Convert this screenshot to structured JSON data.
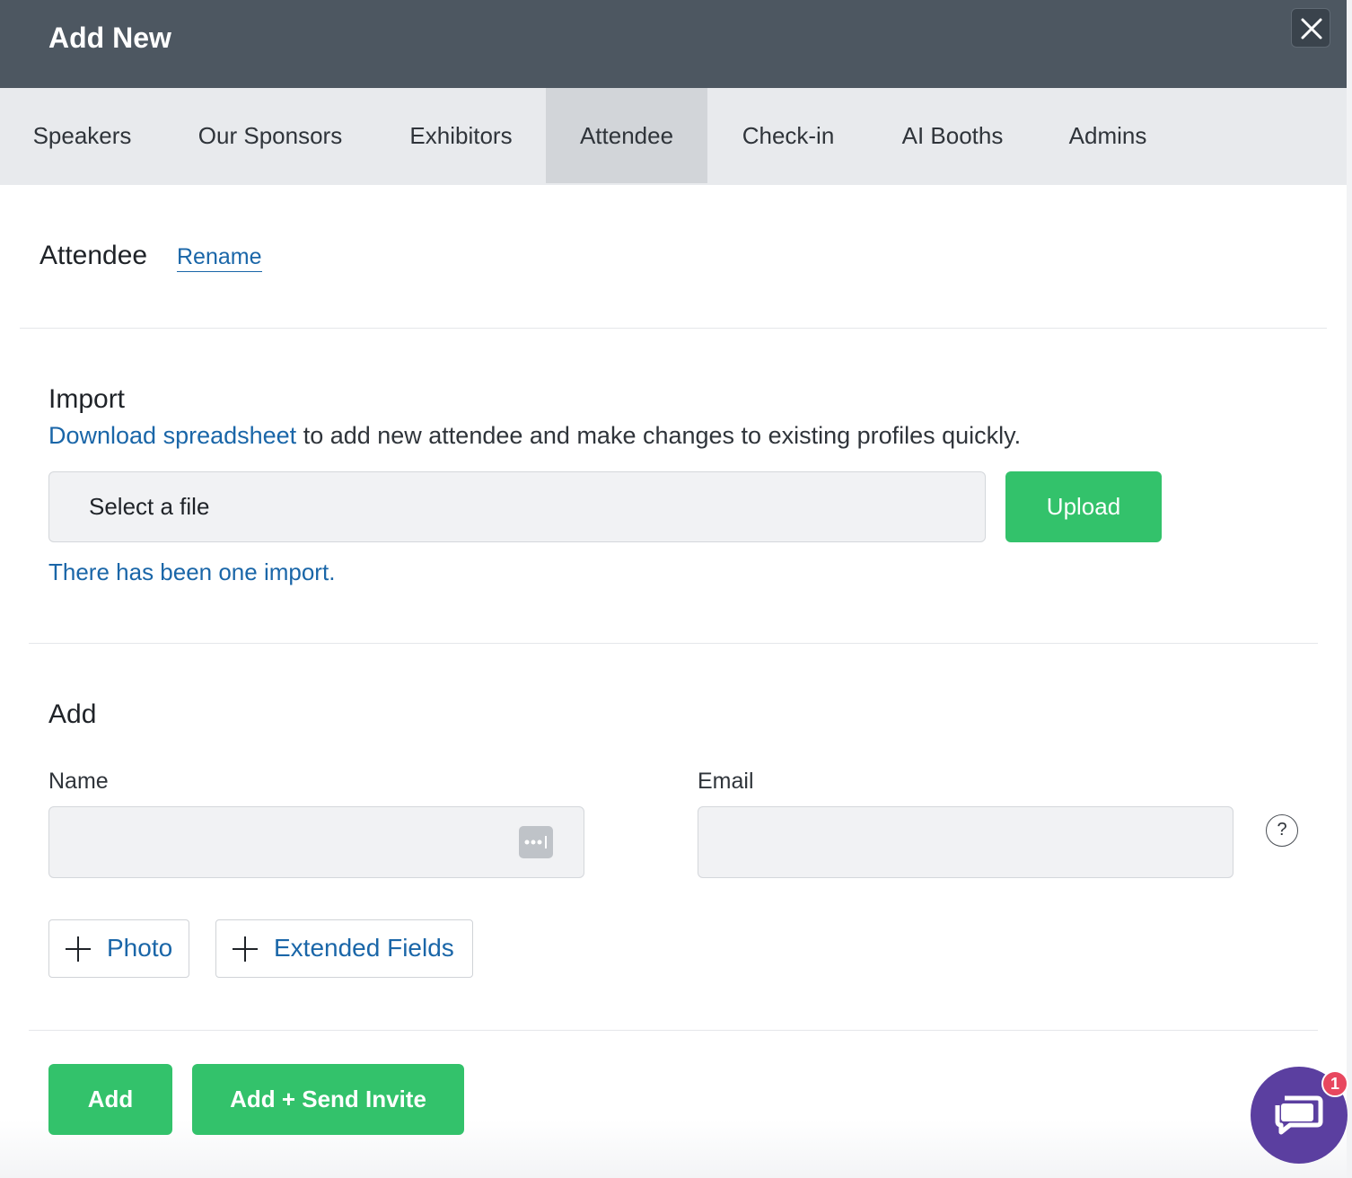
{
  "header": {
    "title": "Add New",
    "close_icon": "close-icon"
  },
  "tabs": [
    {
      "label": "Speakers",
      "active": false
    },
    {
      "label": "Our Sponsors",
      "active": false
    },
    {
      "label": "Exhibitors",
      "active": false
    },
    {
      "label": "Attendee",
      "active": true
    },
    {
      "label": "Check-in",
      "active": false
    },
    {
      "label": "AI Booths",
      "active": false
    },
    {
      "label": "Admins",
      "active": false
    }
  ],
  "section": {
    "title": "Attendee",
    "rename_label": "Rename"
  },
  "import": {
    "title": "Import",
    "download_link": "Download spreadsheet",
    "description": " to add new attendee and make changes to existing profiles quickly.",
    "file_placeholder": "Select a file",
    "upload_label": "Upload",
    "note": "There has been one import."
  },
  "add": {
    "title": "Add",
    "name_label": "Name",
    "email_label": "Email",
    "name_value": "",
    "email_value": "",
    "help_label": "?",
    "photo_label": "Photo",
    "extended_fields_label": "Extended Fields"
  },
  "footer": {
    "add_label": "Add",
    "add_invite_label": "Add + Send Invite"
  },
  "chat": {
    "badge_count": "1"
  },
  "colors": {
    "header_bg": "#4d5761",
    "accent_green": "#33c26b",
    "link_blue": "#1a66a8",
    "chat_purple": "#5b3fa0",
    "badge_red": "#e8475f"
  }
}
